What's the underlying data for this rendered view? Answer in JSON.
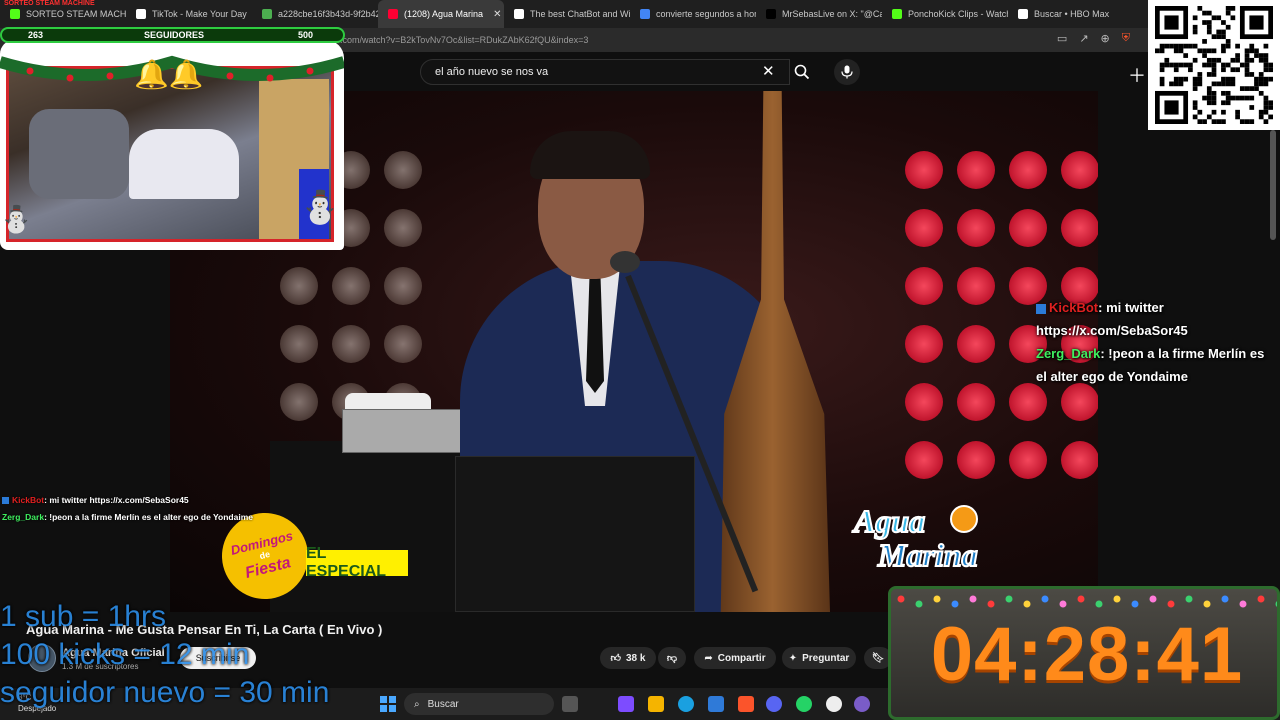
{
  "browser": {
    "tabs": [
      {
        "label": "SORTEO STEAM MACHINE",
        "fav": "#53fc18",
        "active": false
      },
      {
        "label": "TikTok - Make Your Day",
        "fav": "#ffffff",
        "active": false
      },
      {
        "label": "a228cbe16f3b43d-9f2b42",
        "fav": "#4caf50",
        "active": false
      },
      {
        "label": "(1208) Agua Marina",
        "fav": "#ff0033",
        "active": true
      },
      {
        "label": "The best ChatBot and Wid",
        "fav": "#ffffff",
        "active": false
      },
      {
        "label": "convierte segundos a hora",
        "fav": "#4285f4",
        "active": false
      },
      {
        "label": "MrSebasLive on X: \"@Cara",
        "fav": "#000000",
        "active": false
      },
      {
        "label": "PonchoKick Clips - Watch",
        "fav": "#53fc18",
        "active": false
      },
      {
        "label": "Buscar • HBO Max",
        "fav": "#ffffff",
        "active": false
      }
    ],
    "url": "youtube.com/watch?v=B2kTovNv7Oc&list=RDukZAbK62fQU&index=3"
  },
  "youtube": {
    "search_query": "el año nuevo se nos va",
    "video_title": "Agua Marina - Me Gusta Pensar En Ti, La Carta ( En Vivo )",
    "channel_name": "Agua Marina Oficial",
    "channel_subs": "1.3 M de suscriptores",
    "subscribe_label": "Suscribirse",
    "likes": "38 k",
    "share_label": "Compartir",
    "ask_label": "Preguntar"
  },
  "video_overlay": {
    "fiesta_line1": "Domingos",
    "fiesta_line2": "de",
    "fiesta_line3": "Fiesta",
    "especial": "EL ESPECIAL",
    "am_line1": "Agua",
    "am_line2": "Marina"
  },
  "stream": {
    "sorteo": "SORTEO STEAM MACHINE",
    "follower_count": "263",
    "follower_label": "SEGUIDORES",
    "follower_goal": "500",
    "rules": [
      "1 sub = 1hrs",
      "100 kicks = 12 min",
      "seguidor nuevo = 30 min"
    ],
    "timer": "04:28:41"
  },
  "chat": {
    "messages": [
      {
        "user": "KickBot",
        "text": ": mi twitter https://x.com/SebaSor45",
        "user_color": "#e02020"
      },
      {
        "user": "Zerg_Dark",
        "text": ": !peon a la firme Merlín es el alter ego de Yondaime",
        "user_color": "#3fef5f"
      }
    ]
  },
  "taskbar": {
    "search_label": "Buscar",
    "weather_temp": "8°C",
    "weather_desc": "Despejado"
  }
}
